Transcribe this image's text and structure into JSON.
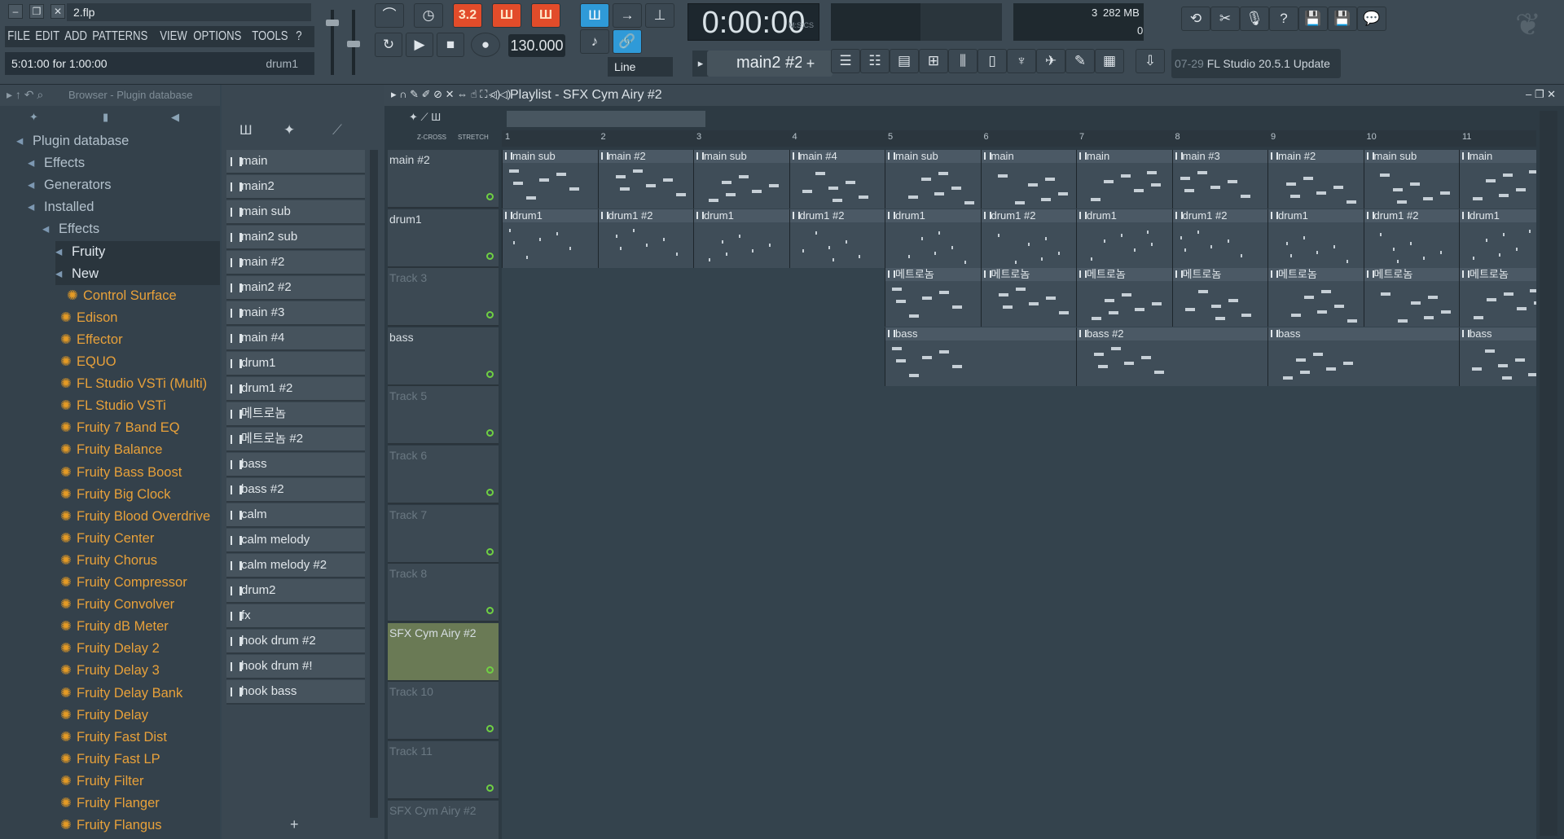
{
  "window": {
    "filename": "2.flp"
  },
  "menu": [
    "FILE",
    "EDIT",
    "ADD",
    "PATTERNS",
    "VIEW",
    "OPTIONS",
    "TOOLS",
    "?"
  ],
  "hint": {
    "text": "5:01:00 for 1:00:00",
    "channel": "drum1"
  },
  "transport": {
    "tempo": "130.000",
    "time": "0:00:00",
    "time_unit": "M:S:CS",
    "pattern": "main2 #2",
    "snap": "Line",
    "pattern_mode_label": "3.2"
  },
  "cpu": {
    "value": "3",
    "memory": "282 MB",
    "poly": "0"
  },
  "news": {
    "date": "07-29",
    "text": "FL Studio 20.5.1 Update"
  },
  "browser": {
    "header": "Browser - Plugin database",
    "items": [
      {
        "label": "Plugin database",
        "kind": "root"
      },
      {
        "label": "Effects",
        "kind": "folder"
      },
      {
        "label": "Generators",
        "kind": "folder"
      },
      {
        "label": "Installed",
        "kind": "folder"
      },
      {
        "label": "Effects",
        "kind": "folder"
      },
      {
        "label": "Fruity",
        "kind": "folder"
      },
      {
        "label": "New",
        "kind": "folder"
      },
      {
        "label": "Control Surface",
        "kind": "plugin"
      },
      {
        "label": "Edison",
        "kind": "plugin"
      },
      {
        "label": "Effector",
        "kind": "plugin"
      },
      {
        "label": "EQUO",
        "kind": "plugin"
      },
      {
        "label": "FL Studio VSTi (Multi)",
        "kind": "plugin"
      },
      {
        "label": "FL Studio VSTi",
        "kind": "plugin"
      },
      {
        "label": "Fruity 7 Band EQ",
        "kind": "plugin"
      },
      {
        "label": "Fruity Balance",
        "kind": "plugin"
      },
      {
        "label": "Fruity Bass Boost",
        "kind": "plugin"
      },
      {
        "label": "Fruity Big Clock",
        "kind": "plugin"
      },
      {
        "label": "Fruity Blood Overdrive",
        "kind": "plugin"
      },
      {
        "label": "Fruity Center",
        "kind": "plugin"
      },
      {
        "label": "Fruity Chorus",
        "kind": "plugin"
      },
      {
        "label": "Fruity Compressor",
        "kind": "plugin"
      },
      {
        "label": "Fruity Convolver",
        "kind": "plugin"
      },
      {
        "label": "Fruity dB Meter",
        "kind": "plugin"
      },
      {
        "label": "Fruity Delay 2",
        "kind": "plugin"
      },
      {
        "label": "Fruity Delay 3",
        "kind": "plugin"
      },
      {
        "label": "Fruity Delay Bank",
        "kind": "plugin"
      },
      {
        "label": "Fruity Delay",
        "kind": "plugin"
      },
      {
        "label": "Fruity Fast Dist",
        "kind": "plugin"
      },
      {
        "label": "Fruity Fast LP",
        "kind": "plugin"
      },
      {
        "label": "Fruity Filter",
        "kind": "plugin"
      },
      {
        "label": "Fruity Flanger",
        "kind": "plugin"
      },
      {
        "label": "Fruity Flangus",
        "kind": "plugin"
      }
    ]
  },
  "patterns": [
    "main",
    "main2",
    "main sub",
    "main2 sub",
    "main #2",
    "main2 #2",
    "main #3",
    "main #4",
    "drum1",
    "drum1 #2",
    "메트로놈",
    "메트로놈 #2",
    "bass",
    "bass #2",
    "calm",
    "calm melody",
    "calm melody #2",
    "drum2",
    "fx",
    "hook drum #2",
    "hook drum #!",
    "hook bass"
  ],
  "playlist": {
    "title": "Playlist - SFX Cym Airy #2",
    "zcross": "Z-CROSS",
    "stretch": "STRETCH",
    "bars": [
      "1",
      "2",
      "3",
      "4",
      "5",
      "6",
      "7",
      "8",
      "9",
      "10",
      "11"
    ],
    "tracks": [
      "main #2",
      "drum1",
      "Track 3",
      "bass",
      "Track 5",
      "Track 6",
      "Track 7",
      "Track 8",
      "SFX Cym Airy #2",
      "Track 10",
      "Track 11",
      "SFX Cym Airy #2"
    ],
    "row1_clips": [
      "main sub",
      "main #2",
      "main sub",
      "main #4",
      "main sub",
      "main",
      "main",
      "main #3",
      "main #2",
      "main sub",
      "main"
    ],
    "row2_clips": [
      "drum1",
      "drum1 #2",
      "drum1",
      "drum1 #2",
      "drum1",
      "drum1 #2",
      "drum1",
      "drum1 #2",
      "drum1",
      "drum1 #2",
      "drum1"
    ],
    "row3_clips": [
      "메트로놈",
      "메트로놈",
      "메트로놈",
      "메트로놈",
      "메트로놈",
      "메트로놈",
      "메트로놈"
    ],
    "row4_clips": [
      "bass",
      "bass #2",
      "bass",
      "bass"
    ]
  },
  "colors": {
    "accent_orange": "#e24c2a",
    "accent_blue": "#2f9ad8",
    "track_led": "#6fd043",
    "plugin_text": "#e8a13a"
  }
}
